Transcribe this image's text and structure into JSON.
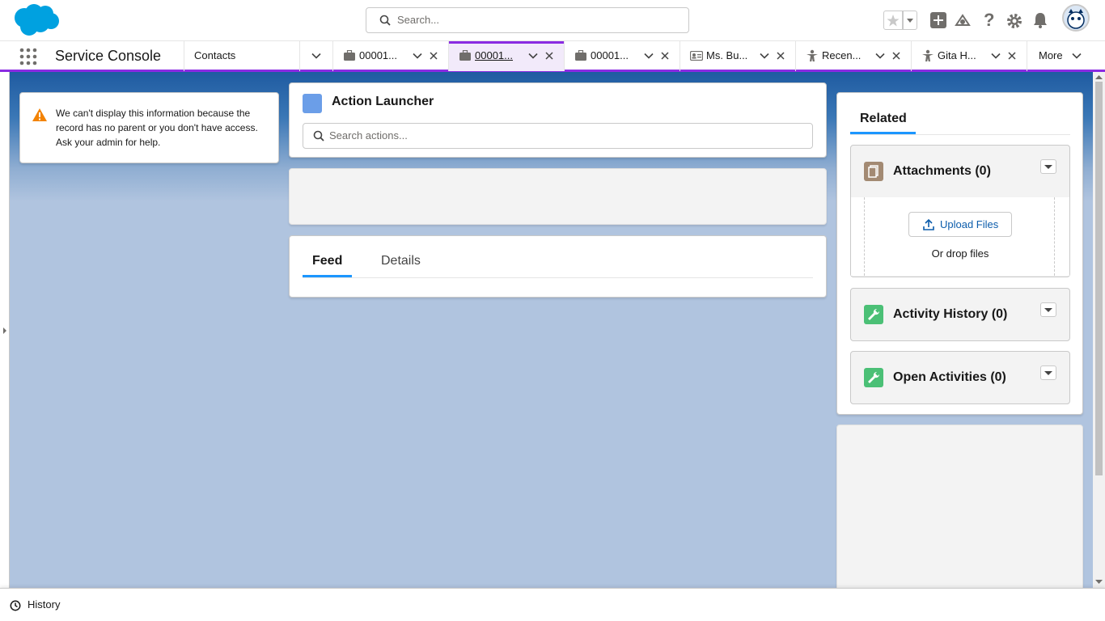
{
  "header": {
    "search_placeholder": "Search..."
  },
  "nav": {
    "app_name": "Service Console",
    "object_tab": "Contacts",
    "tabs": [
      {
        "label": "00001...",
        "icon": "case-icon"
      },
      {
        "label": "00001...",
        "icon": "case-icon",
        "active": true
      },
      {
        "label": "00001...",
        "icon": "case-icon"
      },
      {
        "label": "Ms. Bu...",
        "icon": "contact-card-icon"
      },
      {
        "label": "Recen...",
        "icon": "person-icon"
      },
      {
        "label": "Gita H...",
        "icon": "person-icon"
      }
    ],
    "more_label": "More"
  },
  "warning": {
    "text": "We can't display this information because the record has no parent or you don't have access. Ask your admin for help."
  },
  "action_launcher": {
    "title": "Action Launcher",
    "search_placeholder": "Search actions..."
  },
  "feed_tabs": {
    "feed": "Feed",
    "details": "Details"
  },
  "related": {
    "tab": "Related",
    "attachments": "Attachments (0)",
    "upload_button": "Upload Files",
    "drop_text": "Or drop files",
    "activity_history": "Activity History (0)",
    "open_activities": "Open Activities (0)"
  },
  "footer": {
    "history": "History"
  },
  "colors": {
    "brand_blue": "#00a1e0",
    "accent_purple": "#8a2be2",
    "link_blue": "#0b5cab",
    "warning_orange": "#f38303",
    "attachment_icon": "#a38a73",
    "activity_icon": "#4bc076"
  }
}
